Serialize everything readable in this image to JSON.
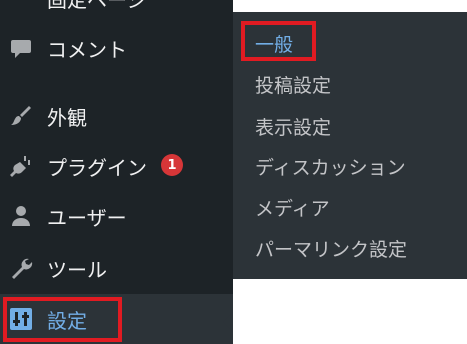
{
  "sidebar": {
    "top_item": "固定ページ",
    "comments": "コメント",
    "appearance": "外観",
    "plugins": "プラグイン",
    "plugins_badge": "1",
    "users": "ユーザー",
    "tools": "ツール",
    "settings": "設定"
  },
  "submenu": {
    "items": [
      "一般",
      "投稿設定",
      "表示設定",
      "ディスカッション",
      "メディア",
      "パーマリンク設定"
    ]
  },
  "colors": {
    "sidebar_bg": "#1d2327",
    "submenu_bg": "#2c3338",
    "active_text": "#72aee6",
    "badge": "#d63638",
    "highlight_border": "#e11b22"
  }
}
